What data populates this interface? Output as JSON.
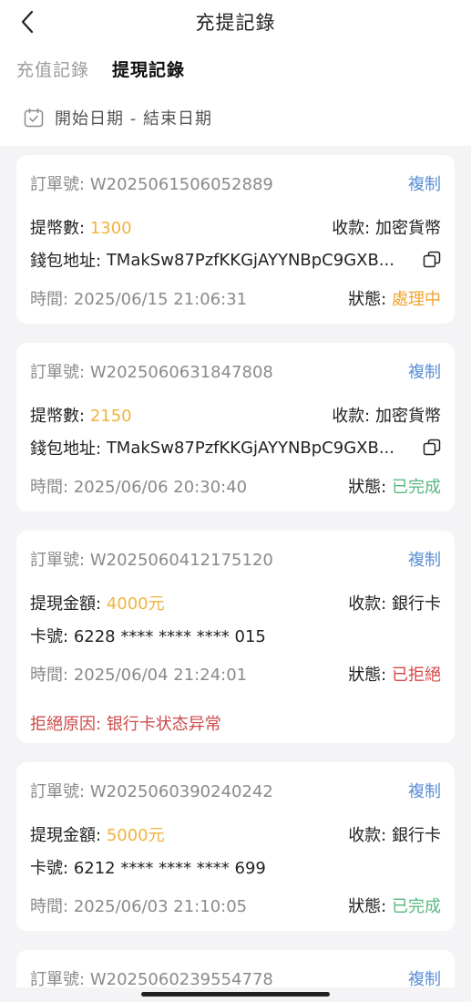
{
  "header": {
    "title": "充提記錄"
  },
  "tabs": [
    {
      "label": "充值記錄"
    },
    {
      "label": "提現記錄"
    }
  ],
  "date_filter": {
    "label": "開始日期 - 結束日期"
  },
  "records": [
    {
      "order_label": "訂單號:",
      "order_no": "W2025061506052889",
      "copy_label": "複制",
      "amount_label": "提幣數:",
      "amount": "1300",
      "receive_label": "收款:",
      "receive_method": "加密貨幣",
      "detail_label": "錢包地址:",
      "detail_value": "TMakSw87PzfKKGjAYYNBpC9GXB...",
      "time_label": "時間:",
      "time": "2025/06/15 21:06:31",
      "status_label": "狀態:",
      "status": "處理中",
      "status_color": "#f0a431"
    },
    {
      "order_label": "訂單號:",
      "order_no": "W2025060631847808",
      "copy_label": "複制",
      "amount_label": "提幣數:",
      "amount": "2150",
      "receive_label": "收款:",
      "receive_method": "加密貨幣",
      "detail_label": "錢包地址:",
      "detail_value": "TMakSw87PzfKKGjAYYNBpC9GXB...",
      "time_label": "時間:",
      "time": "2025/06/06 20:30:40",
      "status_label": "狀態:",
      "status": "已完成",
      "status_color": "#58b77f"
    },
    {
      "order_label": "訂單號:",
      "order_no": "W2025060412175120",
      "copy_label": "複制",
      "amount_label": "提現金額:",
      "amount": "4000元",
      "receive_label": "收款:",
      "receive_method": "銀行卡",
      "detail_label": "卡號:",
      "detail_value": "6228 **** **** **** 015",
      "time_label": "時間:",
      "time": "2025/06/04 21:24:01",
      "status_label": "狀態:",
      "status": "已拒絕",
      "status_color": "#d84848",
      "reject_label": "拒絕原因:",
      "reject_reason": "银行卡状态异常"
    },
    {
      "order_label": "訂單號:",
      "order_no": "W2025060390240242",
      "copy_label": "複制",
      "amount_label": "提現金額:",
      "amount": "5000元",
      "receive_label": "收款:",
      "receive_method": "銀行卡",
      "detail_label": "卡號:",
      "detail_value": "6212 **** **** **** 699",
      "time_label": "時間:",
      "time": "2025/06/03 21:10:05",
      "status_label": "狀態:",
      "status": "已完成",
      "status_color": "#58b77f"
    },
    {
      "order_label": "訂單號:",
      "order_no": "W2025060239554778",
      "copy_label": "複制"
    }
  ]
}
